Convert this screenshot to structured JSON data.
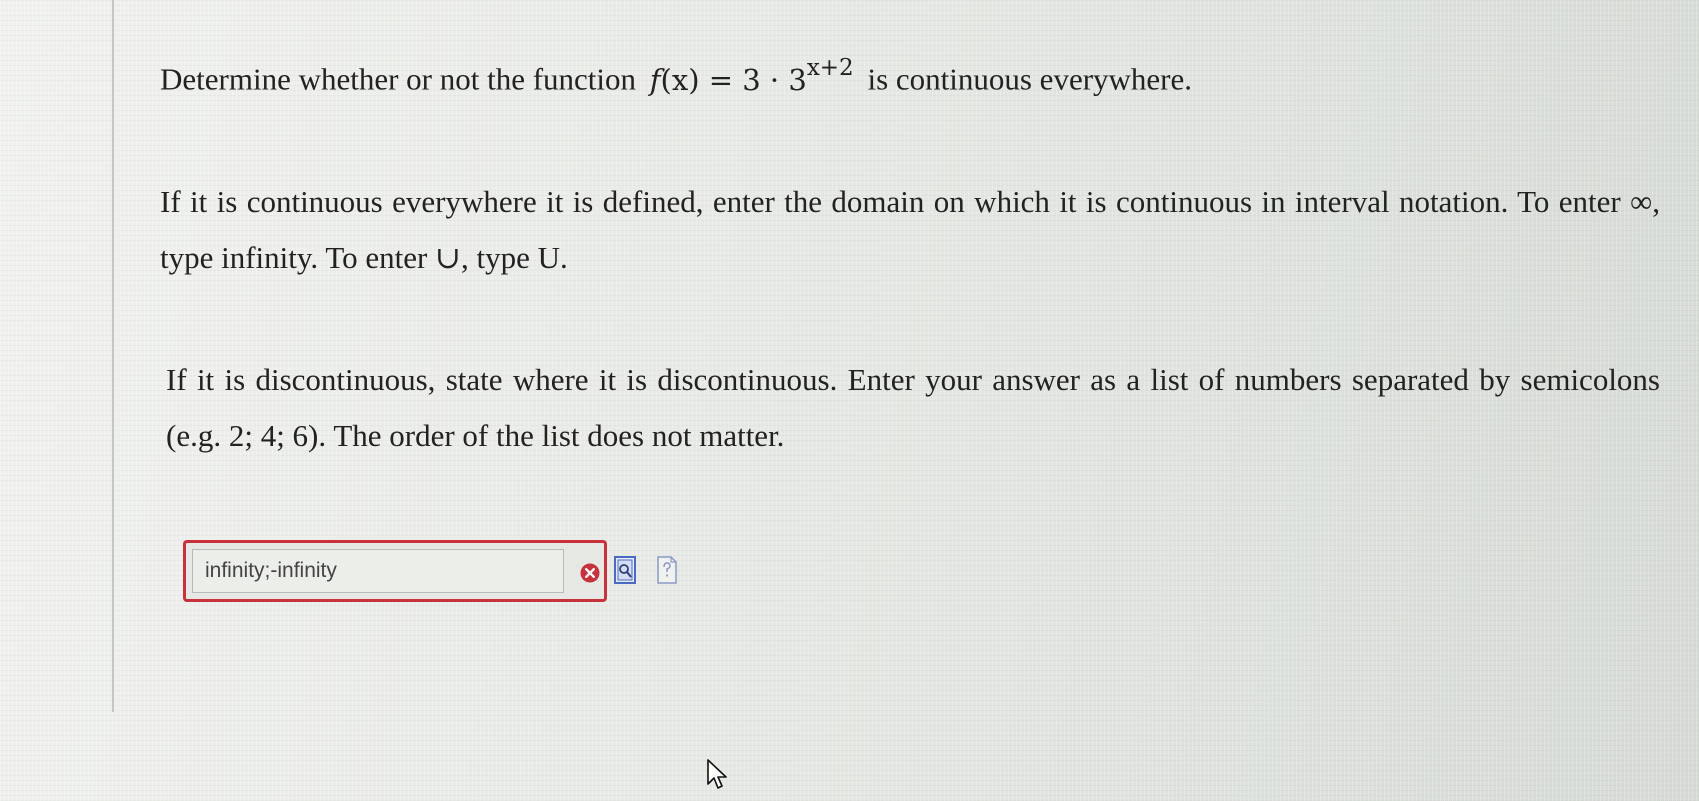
{
  "question": {
    "prefix": "Determine whether or not the function",
    "math_fn": "f",
    "math_arg": "(x)",
    "math_eq": " = 3 · 3",
    "math_exp": "x+2",
    "suffix": "is continuous everywhere."
  },
  "instructions": {
    "continuous": "If it is continuous everywhere it is defined, enter the domain on which it is continuous in interval notation. To enter ∞, type infinity. To enter ∪, type U.",
    "discontinuous": "If it is discontinuous, state where it is discontinuous. Enter your answer as a list of numbers separated by semicolons (e.g. 2; 4; 6). The order of the list does not matter."
  },
  "answer": {
    "value": "infinity;-infinity",
    "status": "incorrect"
  },
  "icons": {
    "error": "x-circle-icon",
    "preview": "preview-document-icon",
    "help": "help-document-icon",
    "cursor": "mouse-pointer-icon"
  },
  "colors": {
    "error_border": "#c8323c",
    "error_icon": "#c8323c",
    "icon_accent": "#4a6bc4"
  }
}
